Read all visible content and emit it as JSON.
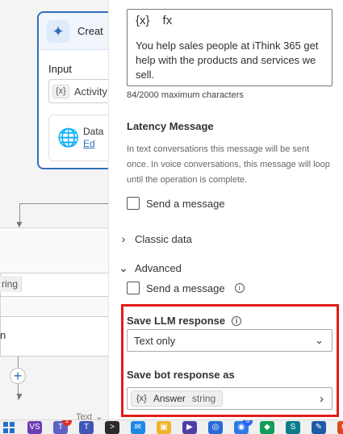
{
  "canvas": {
    "create_title": "Creat",
    "input_label": "Input",
    "input_chip_symbol": "{x}",
    "input_chip_text": "Activity",
    "data_label": "Data",
    "data_link_text": "Ed",
    "left_tag": "ring",
    "left_row_text": "n",
    "plus_symbol": "+",
    "text_mode_label": "Text"
  },
  "panel": {
    "toolbar": {
      "variable_icon_text": "{x}",
      "fx_icon_text": "fx"
    },
    "prompt_text": "You help sales people at iThink 365 get help with the products and services we sell.",
    "char_counter": "84/2000 maximum characters",
    "latency": {
      "title": "Latency Message",
      "description": "In text conversations this message will be sent once. In voice conversations, this message will loop until the operation is complete.",
      "send_message_label": "Send a message"
    },
    "classic_data": {
      "label": "Classic data"
    },
    "advanced": {
      "label": "Advanced",
      "send_message_label": "Send a message"
    },
    "save_llm_response": {
      "label": "Save LLM response",
      "selected": "Text only"
    },
    "save_bot_response": {
      "label": "Save bot response as",
      "variable_symbol": "{x}",
      "variable_name": "Answer",
      "variable_type": "string"
    }
  },
  "taskbar": {
    "items": [
      {
        "name": "windows-start-icon",
        "text": "",
        "color": "#1f6fd1"
      },
      {
        "name": "visual-studio-icon",
        "text": "VS",
        "color": "#6c3db4"
      },
      {
        "name": "teams-icon",
        "text": "T",
        "color": "#5c63c3",
        "badge": "1"
      },
      {
        "name": "teams-alt-icon",
        "text": "T",
        "color": "#3f56b5"
      },
      {
        "name": "terminal-icon",
        "text": ">",
        "color": "#2b2b2b"
      },
      {
        "name": "mail-icon",
        "text": "✉",
        "color": "#1e88e5"
      },
      {
        "name": "folder-icon",
        "text": "▣",
        "color": "#f0b429"
      },
      {
        "name": "media-icon",
        "text": "▶",
        "color": "#4d3fa6"
      },
      {
        "name": "browser-icon",
        "text": "◎",
        "color": "#2a6ad8"
      },
      {
        "name": "chat-icon",
        "text": "◉",
        "color": "#2c7be5",
        "badge": "8"
      },
      {
        "name": "app-icon",
        "text": "◆",
        "color": "#0f9d58"
      },
      {
        "name": "sharepoint-icon",
        "text": "S",
        "color": "#0b7b8b"
      },
      {
        "name": "notes-icon",
        "text": "✎",
        "color": "#1e5aa8"
      },
      {
        "name": "office-icon",
        "text": "O",
        "color": "#d94c1a"
      },
      {
        "name": "phone-icon",
        "text": "☎",
        "color": "#4caf50"
      }
    ]
  }
}
